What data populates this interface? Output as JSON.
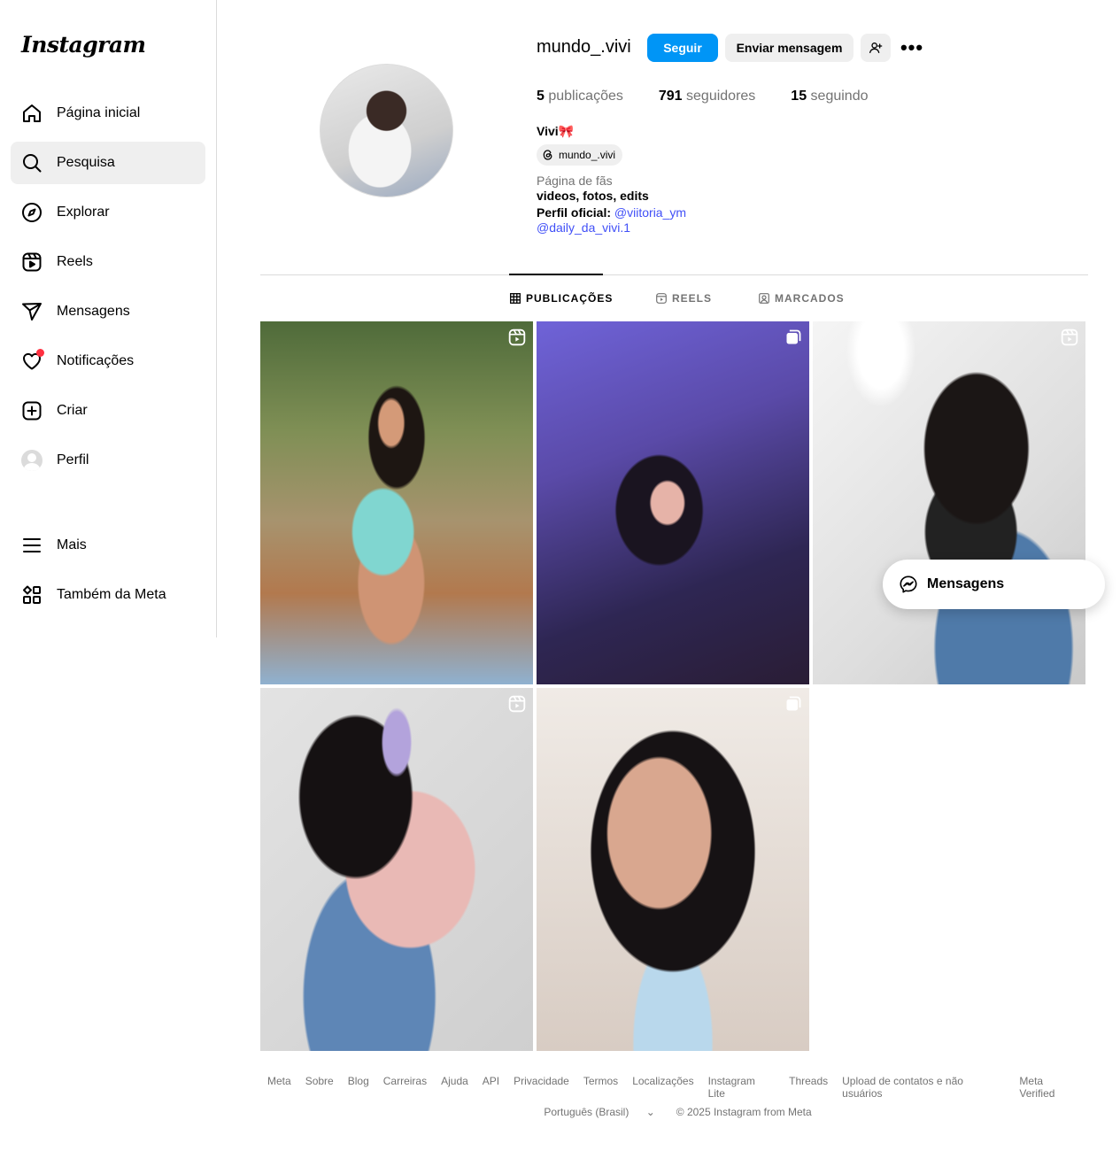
{
  "brand": {
    "logo_text": "Instagram"
  },
  "sidebar": {
    "items": [
      {
        "label": "Página inicial",
        "icon": "home-icon"
      },
      {
        "label": "Pesquisa",
        "icon": "search-icon"
      },
      {
        "label": "Explorar",
        "icon": "compass-icon"
      },
      {
        "label": "Reels",
        "icon": "reels-icon"
      },
      {
        "label": "Mensagens",
        "icon": "send-icon"
      },
      {
        "label": "Notificações",
        "icon": "heart-icon"
      },
      {
        "label": "Criar",
        "icon": "plus-square-icon"
      },
      {
        "label": "Perfil",
        "icon": "avatar-icon"
      },
      {
        "label": "Mais",
        "icon": "menu-icon"
      },
      {
        "label": "Também da Meta",
        "icon": "meta-apps-icon"
      }
    ],
    "active": "Pesquisa"
  },
  "profile": {
    "username": "mundo_.vivi",
    "follow_label": "Seguir",
    "message_label": "Enviar mensagem",
    "more_label": "•••",
    "stats": {
      "posts_count": "5",
      "posts_label": "publicações",
      "followers_count": "791",
      "followers_label": "seguidores",
      "following_count": "15",
      "following_label": "seguindo"
    },
    "display_name": "Vivi🎀",
    "threads_handle": "mundo_.vivi",
    "category": "Página de fãs",
    "bio_line1": "videos, fotos, edits",
    "bio_line2_label": "Perfil oficial:",
    "bio_line2_link": "@viitoria_ym",
    "bio_line3_link": "@daily_da_vivi.1"
  },
  "tabs": [
    {
      "label": "PUBLICAÇÕES",
      "icon": "grid-icon",
      "active": true
    },
    {
      "label": "REELS",
      "icon": "reels-icon",
      "active": false
    },
    {
      "label": "MARCADOS",
      "icon": "tagged-icon",
      "active": false
    }
  ],
  "posts": [
    {
      "type": "reel"
    },
    {
      "type": "carousel"
    },
    {
      "type": "reel"
    },
    {
      "type": "reel"
    },
    {
      "type": "carousel"
    }
  ],
  "messages_pill": {
    "label": "Mensagens"
  },
  "footer": {
    "links": [
      "Meta",
      "Sobre",
      "Blog",
      "Carreiras",
      "Ajuda",
      "API",
      "Privacidade",
      "Termos",
      "Localizações",
      "Instagram Lite",
      "Threads",
      "Upload de contatos e não usuários",
      "Meta Verified"
    ],
    "language": "Português (Brasil)",
    "copyright": "© 2025 Instagram from Meta"
  }
}
